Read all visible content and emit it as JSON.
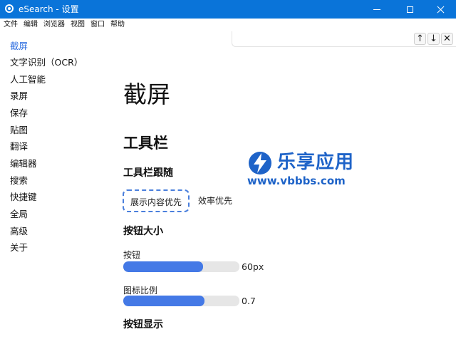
{
  "window": {
    "title": "eSearch - 设置"
  },
  "menu": [
    "文件",
    "编辑",
    "浏览器",
    "视图",
    "窗口",
    "帮助"
  ],
  "find_bar": {
    "up": "↑",
    "down": "↓",
    "close": "✕"
  },
  "sidebar": {
    "items": [
      {
        "label": "截屏",
        "active": true
      },
      {
        "label": "文字识别（OCR）"
      },
      {
        "label": "人工智能"
      },
      {
        "label": "录屏"
      },
      {
        "label": "保存"
      },
      {
        "label": "贴图"
      },
      {
        "label": "翻译"
      },
      {
        "label": "编辑器"
      },
      {
        "label": "搜索"
      },
      {
        "label": "快捷键"
      },
      {
        "label": "全局"
      },
      {
        "label": "高级"
      },
      {
        "label": "关于"
      }
    ]
  },
  "main": {
    "heading": "截屏",
    "toolbar_section": "工具栏",
    "follow": {
      "title": "工具栏跟随",
      "options": [
        "展示内容优先",
        "效率优先"
      ],
      "selected": "展示内容优先"
    },
    "button_size": {
      "title": "按钮大小",
      "button": {
        "label": "按钮",
        "value": "60px",
        "fraction": 0.69
      },
      "icon_ratio": {
        "label": "图标比例",
        "value": "0.7",
        "fraction": 0.7
      }
    },
    "button_display": {
      "title": "按钮显示"
    }
  },
  "watermark": {
    "title": "乐享应用",
    "url": "www.vbbbs.com"
  },
  "colors": {
    "titlebar": "#0a74d9",
    "accent": "#4479e6",
    "active_nav": "#2f6fe0",
    "watermark": "#1e63c8"
  }
}
